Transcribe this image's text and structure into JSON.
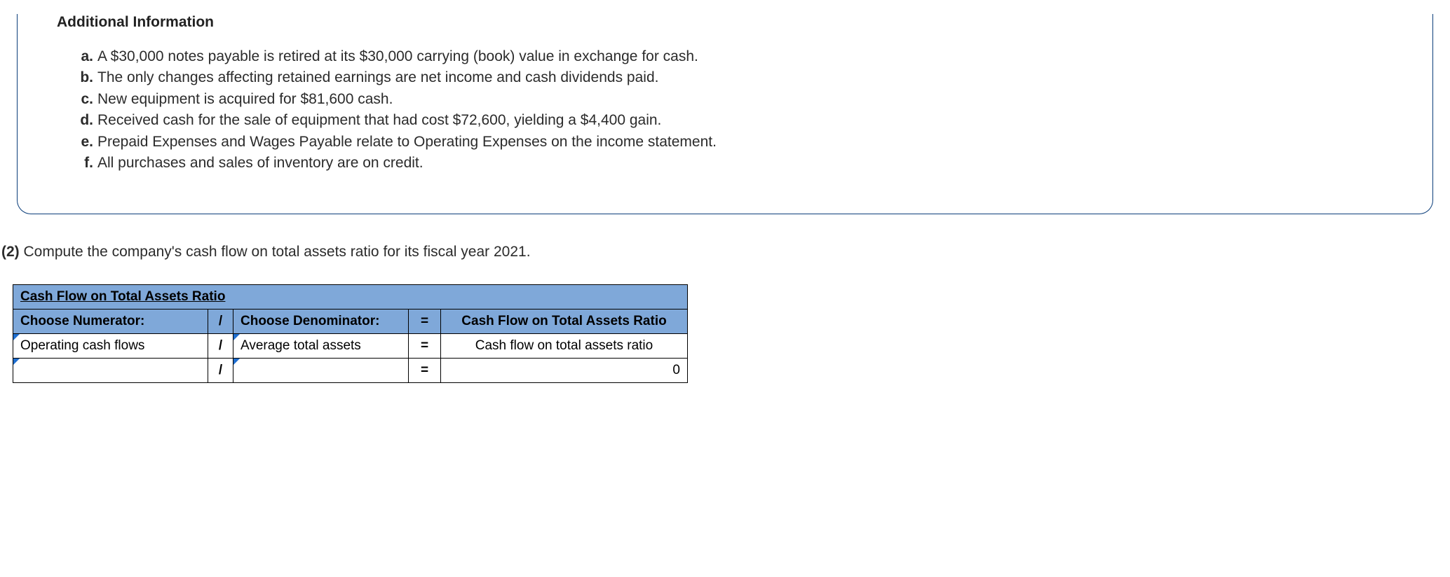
{
  "info": {
    "title": "Additional Information",
    "items": [
      {
        "letter": "a.",
        "text": "A $30,000 notes payable is retired at its $30,000 carrying (book) value in exchange for cash."
      },
      {
        "letter": "b.",
        "text": "The only changes affecting retained earnings are net income and cash dividends paid."
      },
      {
        "letter": "c.",
        "text": "New equipment is acquired for $81,600 cash."
      },
      {
        "letter": "d.",
        "text": "Received cash for the sale of equipment that had cost $72,600, yielding a $4,400 gain."
      },
      {
        "letter": "e.",
        "text": "Prepaid Expenses and Wages Payable relate to Operating Expenses on the income statement."
      },
      {
        "letter": "f.",
        "text": "All purchases and sales of inventory are on credit."
      }
    ]
  },
  "question": {
    "num": "(2)",
    "text": "Compute the company's cash flow on total assets ratio for its fiscal year 2021."
  },
  "table": {
    "title": "Cash Flow on Total Assets Ratio",
    "headers": {
      "numerator": "Choose Numerator:",
      "slash": "/",
      "denominator": "Choose Denominator:",
      "eq": "=",
      "result": "Cash Flow on Total Assets Ratio"
    },
    "row1": {
      "numerator": "Operating cash flows",
      "slash": "/",
      "denominator": "Average total assets",
      "eq": "=",
      "result": "Cash flow on total assets ratio"
    },
    "row2": {
      "numerator": "",
      "slash": "/",
      "denominator": "",
      "eq": "=",
      "result": "0"
    }
  }
}
